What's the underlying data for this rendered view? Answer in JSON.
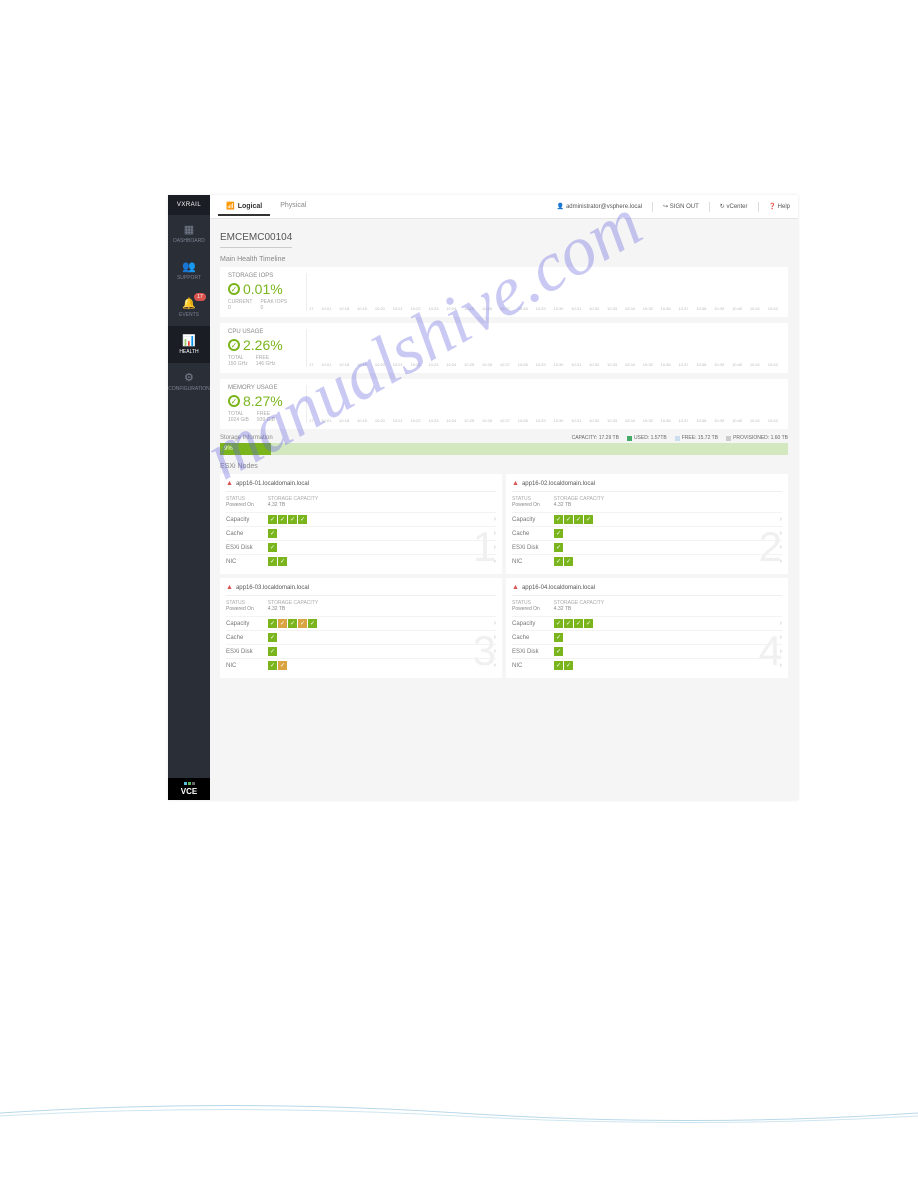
{
  "brand": "VXRAIL",
  "sidebar": {
    "items": [
      {
        "label": "DASHBOARD",
        "icon": "▦"
      },
      {
        "label": "SUPPORT",
        "icon": "👥"
      },
      {
        "label": "EVENTS",
        "icon": "🔔",
        "badge": "17"
      },
      {
        "label": "HEALTH",
        "icon": "📊",
        "active": true
      },
      {
        "label": "CONFIGURATION",
        "icon": "⚙"
      }
    ]
  },
  "footer_brand": "VCE",
  "tabs": [
    {
      "label": "Logical",
      "active": true
    },
    {
      "label": "Physical"
    }
  ],
  "user": "administrator@vsphere.local",
  "top_actions": {
    "signout": "SIGN OUT",
    "vcenter": "vCenter",
    "help": "Help"
  },
  "page_title": "EMCEMC00104",
  "timeline_label": "Main Health Timeline",
  "metrics": [
    {
      "title": "STORAGE IOPS",
      "value": "0.01%",
      "sub": [
        {
          "k": "CURRENT",
          "v": "0"
        },
        {
          "k": "PEAK IOPS",
          "v": "0"
        }
      ]
    },
    {
      "title": "CPU USAGE",
      "value": "2.26%",
      "sub": [
        {
          "k": "TOTAL",
          "v": "150 GHz"
        },
        {
          "k": "FREE",
          "v": "146 GHz"
        }
      ]
    },
    {
      "title": "MEMORY USAGE",
      "value": "8.27%",
      "sub": [
        {
          "k": "TOTAL",
          "v": "1024 GiB"
        },
        {
          "k": "FREE",
          "v": "939 GiB"
        }
      ]
    }
  ],
  "xaxis": [
    "17",
    "10:01",
    "10:18",
    "10:19",
    "10:20",
    "10:21",
    "10:22",
    "10:23",
    "10:24",
    "10:25",
    "10:26",
    "10:27",
    "10:28",
    "10:29",
    "10:30",
    "10:31",
    "10:32",
    "10:33",
    "10:34",
    "10:35",
    "10:36",
    "10:37",
    "10:38",
    "10:39",
    "10:40",
    "10:41",
    "10:42"
  ],
  "storage": {
    "label": "Storage Information",
    "capacity": "CAPACITY: 17.29 TB",
    "used": "USED: 1.57TB",
    "free": "FREE: 15.72 TB",
    "provisioned": "PROVISIONED: 1.60 TB",
    "percent": "9%"
  },
  "nodes_label": "ESXi Nodes",
  "nodes": [
    {
      "num": "1",
      "name": "app16-01.localdomain.local",
      "status": "Powered On",
      "capacity": "4.32 TB",
      "rows": [
        {
          "l": "Capacity",
          "c": [
            "ok",
            "ok",
            "ok",
            "ok"
          ]
        },
        {
          "l": "Cache",
          "c": [
            "ok"
          ]
        },
        {
          "l": "ESXi Disk",
          "c": [
            "ok"
          ]
        },
        {
          "l": "NIC",
          "c": [
            "ok",
            "ok"
          ]
        }
      ]
    },
    {
      "num": "2",
      "name": "app16-02.localdomain.local",
      "status": "Powered On",
      "capacity": "4.32 TB",
      "rows": [
        {
          "l": "Capacity",
          "c": [
            "ok",
            "ok",
            "ok",
            "ok"
          ]
        },
        {
          "l": "Cache",
          "c": [
            "ok"
          ]
        },
        {
          "l": "ESXi Disk",
          "c": [
            "ok"
          ]
        },
        {
          "l": "NIC",
          "c": [
            "ok",
            "ok"
          ]
        }
      ]
    },
    {
      "num": "3",
      "name": "app16-03.localdomain.local",
      "status": "Powered On",
      "capacity": "4.32 TB",
      "rows": [
        {
          "l": "Capacity",
          "c": [
            "ok",
            "warn",
            "ok",
            "warn",
            "ok"
          ]
        },
        {
          "l": "Cache",
          "c": [
            "ok"
          ]
        },
        {
          "l": "ESXi Disk",
          "c": [
            "ok"
          ]
        },
        {
          "l": "NIC",
          "c": [
            "ok",
            "warn"
          ]
        }
      ]
    },
    {
      "num": "4",
      "name": "app16-04.localdomain.local",
      "status": "Powered On",
      "capacity": "4.32 TB",
      "rows": [
        {
          "l": "Capacity",
          "c": [
            "ok",
            "ok",
            "ok",
            "ok"
          ]
        },
        {
          "l": "Cache",
          "c": [
            "ok"
          ]
        },
        {
          "l": "ESXi Disk",
          "c": [
            "ok"
          ]
        },
        {
          "l": "NIC",
          "c": [
            "ok",
            "ok"
          ]
        }
      ]
    }
  ],
  "row_labels": {
    "status": "STATUS",
    "cap": "STORAGE CAPACITY"
  },
  "watermark": "manualshive.com"
}
